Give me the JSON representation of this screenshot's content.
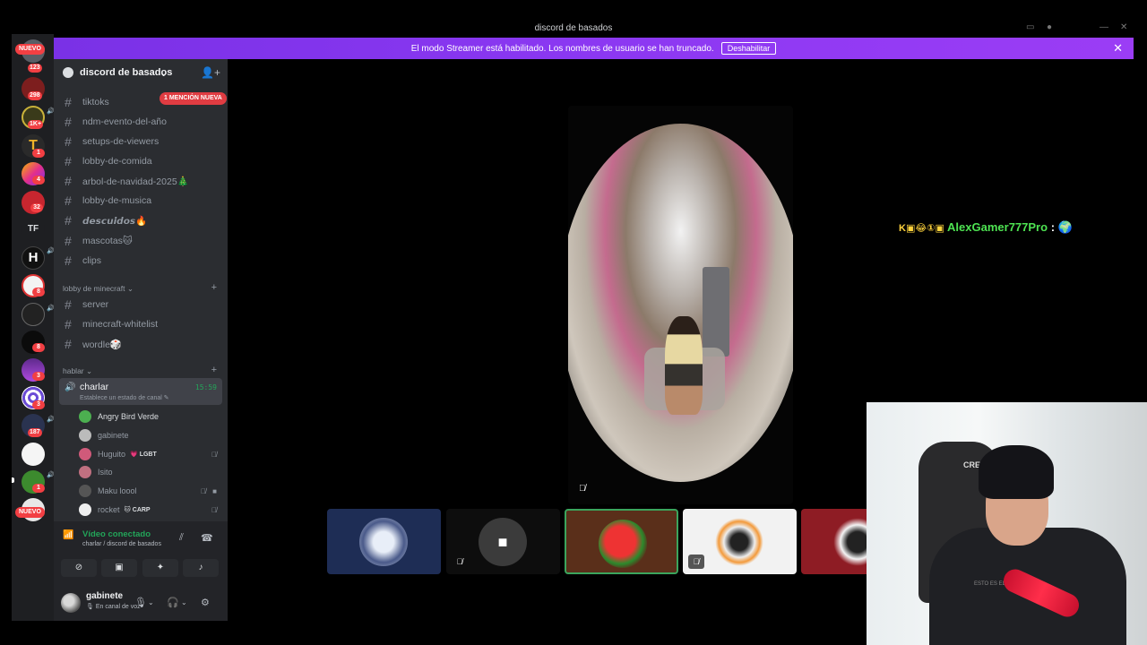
{
  "window": {
    "title": "discord de basados"
  },
  "banner": {
    "message": "El modo Streamer está habilitado. Los nombres de usuario se han truncado.",
    "button": "Deshabilitar"
  },
  "rail": {
    "badges": [
      "123",
      "298",
      "1K+",
      "1",
      "4",
      "32",
      "8",
      "3",
      "3",
      "187",
      "1",
      "8"
    ],
    "tf": "TF",
    "nuevo_top": "NUEVO",
    "nuevo_bottom": "NUEVO"
  },
  "guild": {
    "name": "discord de basados"
  },
  "mention_badge": "1 MENCIÓN NUEVA",
  "channels": [
    {
      "name": "tiktoks"
    },
    {
      "name": "ndm-evento-del-año"
    },
    {
      "name": "setups-de-viewers"
    },
    {
      "name": "lobby-de-comida"
    },
    {
      "name": "arbol-de-navidad-2025🎄"
    },
    {
      "name": "lobby-de-musica"
    },
    {
      "name": "𝙙𝙚𝙨𝙘𝙪𝙞𝙙𝙤𝙨🔥"
    },
    {
      "name": "mascotas🐱"
    },
    {
      "name": "clips"
    }
  ],
  "category_minecraft": {
    "name": "lobby de minecraft",
    "channels": [
      {
        "name": "server"
      },
      {
        "name": "minecraft-whitelist"
      },
      {
        "name": "wordle🎲"
      }
    ]
  },
  "category_hablar": {
    "name": "hablar"
  },
  "voice_channel": {
    "name": "charlar",
    "time": "15:59",
    "status": "Establece un estado de canal ✎"
  },
  "voice_users": [
    {
      "name": "Angry Bird Verde",
      "color": "#4caf50"
    },
    {
      "name": "gabinete",
      "color": "#bbbbbb"
    },
    {
      "name": "Huguito",
      "tag": "💗 LGBT",
      "color": "#d05a7a"
    },
    {
      "name": "Isito",
      "color": "#c07080"
    },
    {
      "name": "Maku loool",
      "color": "#555555"
    },
    {
      "name": "rocket",
      "tag": "🐱 CARP",
      "color": "#eeeeee"
    }
  ],
  "voice_panel": {
    "connected": "Vídeo conectado",
    "location": "charlar / discord de basados"
  },
  "user": {
    "name": "gabinete",
    "status": "🎙 En canal de voz"
  },
  "overlay_chat": {
    "user": "AlexGamer777Pro",
    "separator": ":",
    "emotes": "K▣😂①▣",
    "message_emote": "🌍"
  },
  "tiles": [
    {
      "bg": "#1e2d55",
      "avatar": "#c0c8d8"
    },
    {
      "bg": "#0d0d0d",
      "avatar": "#4a4a4a"
    },
    {
      "bg": "#5a2f1a",
      "avatar": "#d12a2a"
    },
    {
      "bg": "#f2f2f2",
      "avatar": "#e9e2d6"
    },
    {
      "bg": "#8e1c24",
      "avatar": "#f4f4f4"
    }
  ],
  "webcam": {
    "chair_text": "CREO",
    "shirt_text": "ESTO ES EL FUTURO"
  }
}
